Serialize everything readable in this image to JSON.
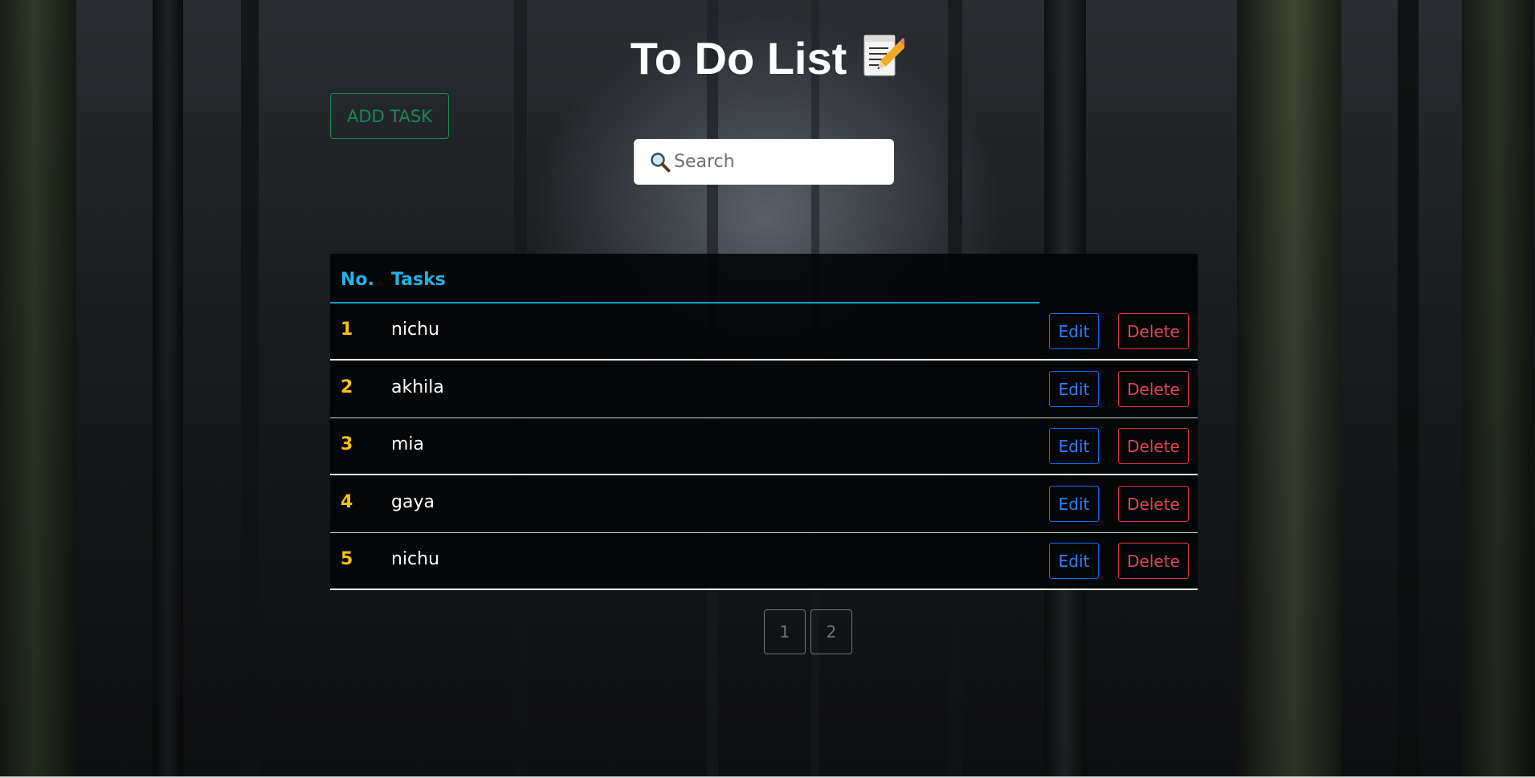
{
  "header": {
    "title": "To Do List",
    "title_icon": "memo-icon"
  },
  "toolbar": {
    "add_task_label": "ADD TASK",
    "add_task_color": "#198754"
  },
  "search": {
    "icon": "search-icon",
    "placeholder": "Search",
    "value": ""
  },
  "table": {
    "columns": [
      "No.",
      "Tasks"
    ],
    "header_color": "#1fb3e6",
    "number_color": "#ffc107",
    "rows": [
      {
        "no": "1",
        "task": "nichu",
        "edit_label": "Edit",
        "delete_label": "Delete"
      },
      {
        "no": "2",
        "task": "akhila",
        "edit_label": "Edit",
        "delete_label": "Delete"
      },
      {
        "no": "3",
        "task": "mia",
        "edit_label": "Edit",
        "delete_label": "Delete"
      },
      {
        "no": "4",
        "task": "gaya",
        "edit_label": "Edit",
        "delete_label": "Delete"
      },
      {
        "no": "5",
        "task": "nichu",
        "edit_label": "Edit",
        "delete_label": "Delete"
      }
    ]
  },
  "pagination": {
    "pages": [
      "1",
      "2"
    ]
  },
  "colors": {
    "edit": "#0d6efd",
    "delete": "#dc3545",
    "page_button": "#6c757d"
  }
}
